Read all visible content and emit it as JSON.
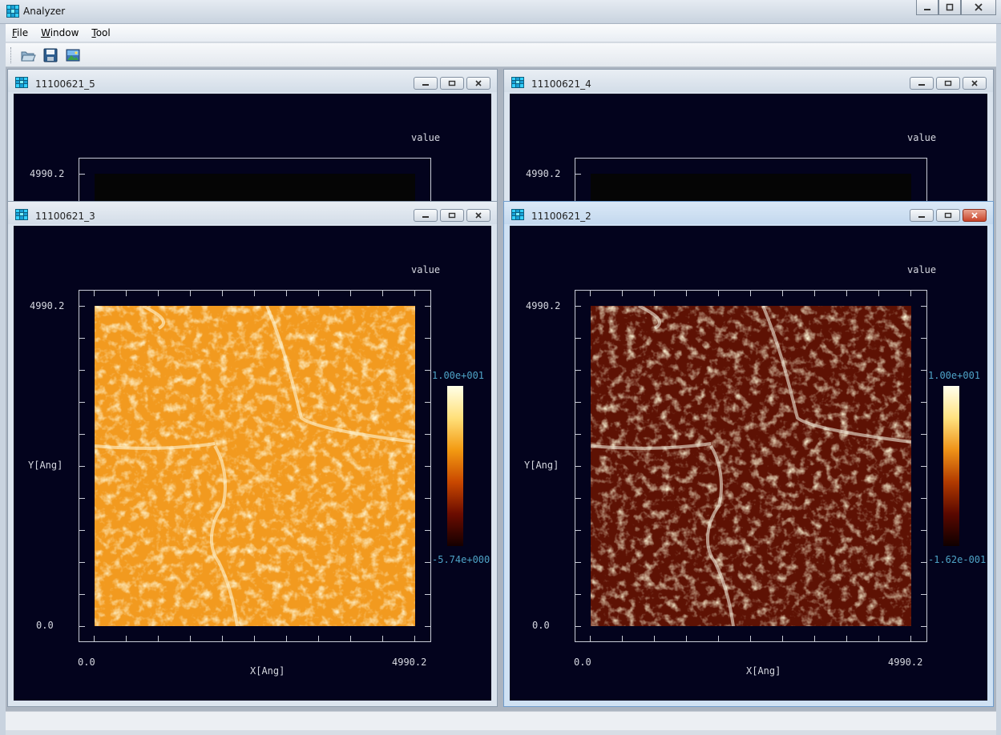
{
  "app": {
    "title": "Analyzer",
    "icon": "app-grid-icon",
    "window_controls": [
      "minimize-icon",
      "maximize-icon",
      "close-icon"
    ]
  },
  "menu": [
    {
      "label": "File",
      "accel": "F",
      "rest": "ile"
    },
    {
      "label": "Window",
      "accel": "W",
      "rest": "indow"
    },
    {
      "label": "Tool",
      "accel": "T",
      "rest": "ool"
    }
  ],
  "toolbar": {
    "buttons": [
      "open-icon",
      "save-icon",
      "image-icon"
    ]
  },
  "windows": [
    {
      "title": "11100621_5",
      "active": false,
      "plot": {
        "value_label": "value",
        "y_top": "4990.2"
      }
    },
    {
      "title": "11100621_4",
      "active": false,
      "plot": {
        "value_label": "value",
        "y_top": "4990.2"
      }
    },
    {
      "title": "11100621_3",
      "active": false,
      "plot": {
        "value_label": "value",
        "y_top": "4990.2",
        "y_bottom": "0.0",
        "y_label": "Y[Ang]",
        "x_left": "0.0",
        "x_right": "4990.2",
        "x_label": "X[Ang]",
        "cbar_max": "1.00e+001",
        "cbar_min": "-5.74e+000",
        "colormap": [
          "#150000",
          "#6b0c00",
          "#c94800",
          "#f39a12",
          "#ffe07a",
          "#ffffe8"
        ],
        "image_base": "#f29a1f"
      }
    },
    {
      "title": "11100621_2",
      "active": true,
      "plot": {
        "value_label": "value",
        "y_top": "4990.2",
        "y_bottom": "0.0",
        "y_label": "Y[Ang]",
        "x_left": "0.0",
        "x_right": "4990.2",
        "x_label": "X[Ang]",
        "cbar_max": "1.00e+001",
        "cbar_min": "-1.62e-001",
        "colormap": [
          "#0f0000",
          "#5a0800",
          "#b13a00",
          "#ef9218",
          "#ffe280",
          "#ffffee"
        ],
        "image_base": "#5e1204"
      }
    }
  ]
}
